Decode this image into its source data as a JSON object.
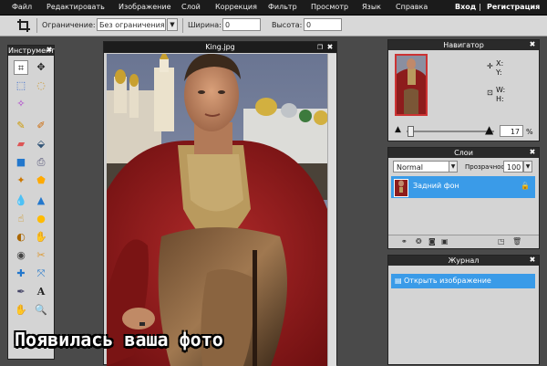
{
  "menu": {
    "items": [
      "Файл",
      "Редактировать",
      "Изображение",
      "Слой",
      "Коррекция",
      "Фильтр",
      "Просмотр",
      "Язык",
      "Справка"
    ],
    "login": "Вход",
    "separator": "|",
    "register": "Регистрация"
  },
  "options": {
    "constraint_label": "Ограничение:",
    "constraint_value": "Без ограничения",
    "width_label": "Ширина:",
    "width_value": "0",
    "height_label": "Высота:",
    "height_value": "0"
  },
  "tools_panel": {
    "title": "Инструмент"
  },
  "document": {
    "title": "King.jpg"
  },
  "navigator": {
    "title": "Навигатор",
    "x_label": "X:",
    "y_label": "Y:",
    "w_label": "W:",
    "h_label": "H:",
    "zoom_value": "17",
    "zoom_unit": "%"
  },
  "layers": {
    "title": "Слои",
    "blend_mode": "Normal",
    "opacity_label": "Прозрачность:",
    "opacity_value": "100",
    "items": [
      {
        "name": "Задний фон"
      }
    ]
  },
  "history": {
    "title": "Журнал",
    "items": [
      {
        "label": "Открыть изображение"
      }
    ]
  },
  "caption": "Появилась ваша фото",
  "colors": {
    "accent": "#3a9be8",
    "menubar": "#1b1b1b",
    "panel": "#d4d4d4",
    "robe": "#9b1c1c"
  }
}
